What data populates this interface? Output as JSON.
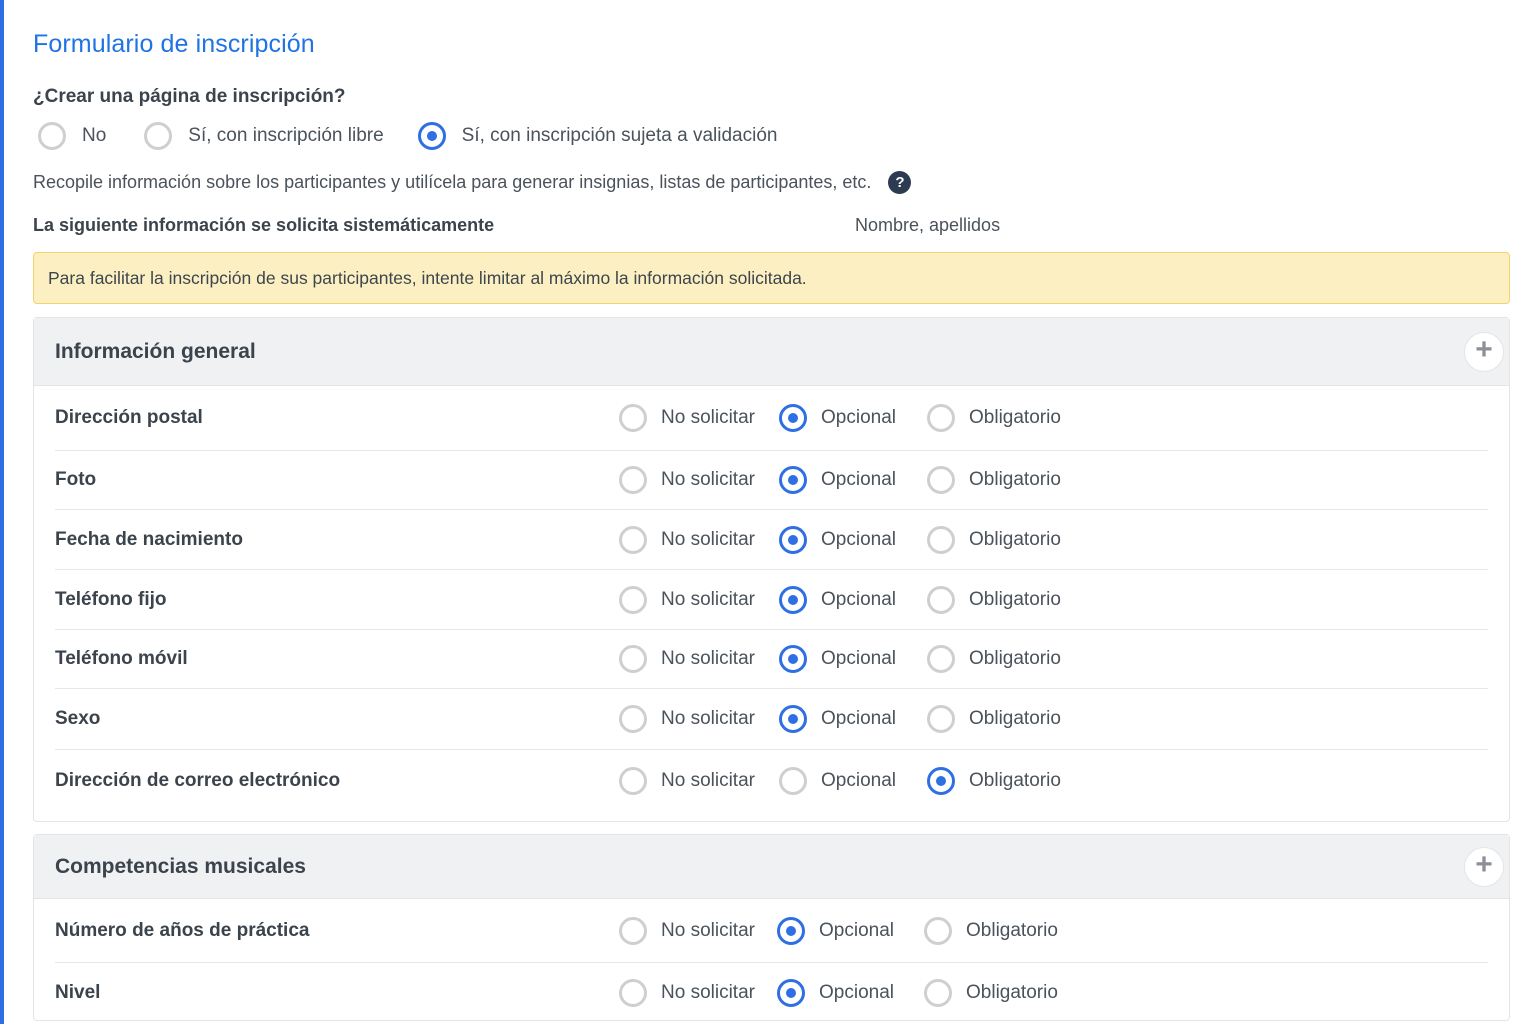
{
  "page": {
    "title": "Formulario de inscripción",
    "question": "¿Crear una página de inscripción?",
    "create_options": [
      {
        "label": "No",
        "checked": false
      },
      {
        "label": "Sí, con inscripción libre",
        "checked": false
      },
      {
        "label": "Sí, con inscripción sujeta a validación",
        "checked": true
      }
    ],
    "description": "Recopile información sobre los participantes y utilícela para generar insignias, listas de participantes, etc.",
    "help_icon": "question-circle-icon",
    "systematic_label": "La siguiente información se solicita sistemáticamente",
    "systematic_value": "Nombre, apellidos",
    "notice": "Para facilitar la inscripción de sus participantes, intente limitar al máximo la información solicitada.",
    "accent_color": "#2f6fe4",
    "notice_color": "#fcf0c2"
  },
  "choices": {
    "none": "No solicitar",
    "optional": "Opcional",
    "required": "Obligatorio"
  },
  "sections": [
    {
      "title": "Información general",
      "add_icon": "plus-icon",
      "fields": [
        {
          "label": "Dirección postal",
          "selected": "optional"
        },
        {
          "label": "Foto",
          "selected": "optional"
        },
        {
          "label": "Fecha de nacimiento",
          "selected": "optional"
        },
        {
          "label": "Teléfono fijo",
          "selected": "optional"
        },
        {
          "label": "Teléfono móvil",
          "selected": "optional"
        },
        {
          "label": "Sexo",
          "selected": "optional"
        },
        {
          "label": "Dirección de correo electrónico",
          "selected": "required"
        }
      ]
    },
    {
      "title": "Competencias musicales",
      "add_icon": "plus-icon",
      "fields": [
        {
          "label": "Número de años de práctica",
          "selected": "optional"
        },
        {
          "label": "Nivel",
          "selected": "optional"
        }
      ]
    }
  ]
}
